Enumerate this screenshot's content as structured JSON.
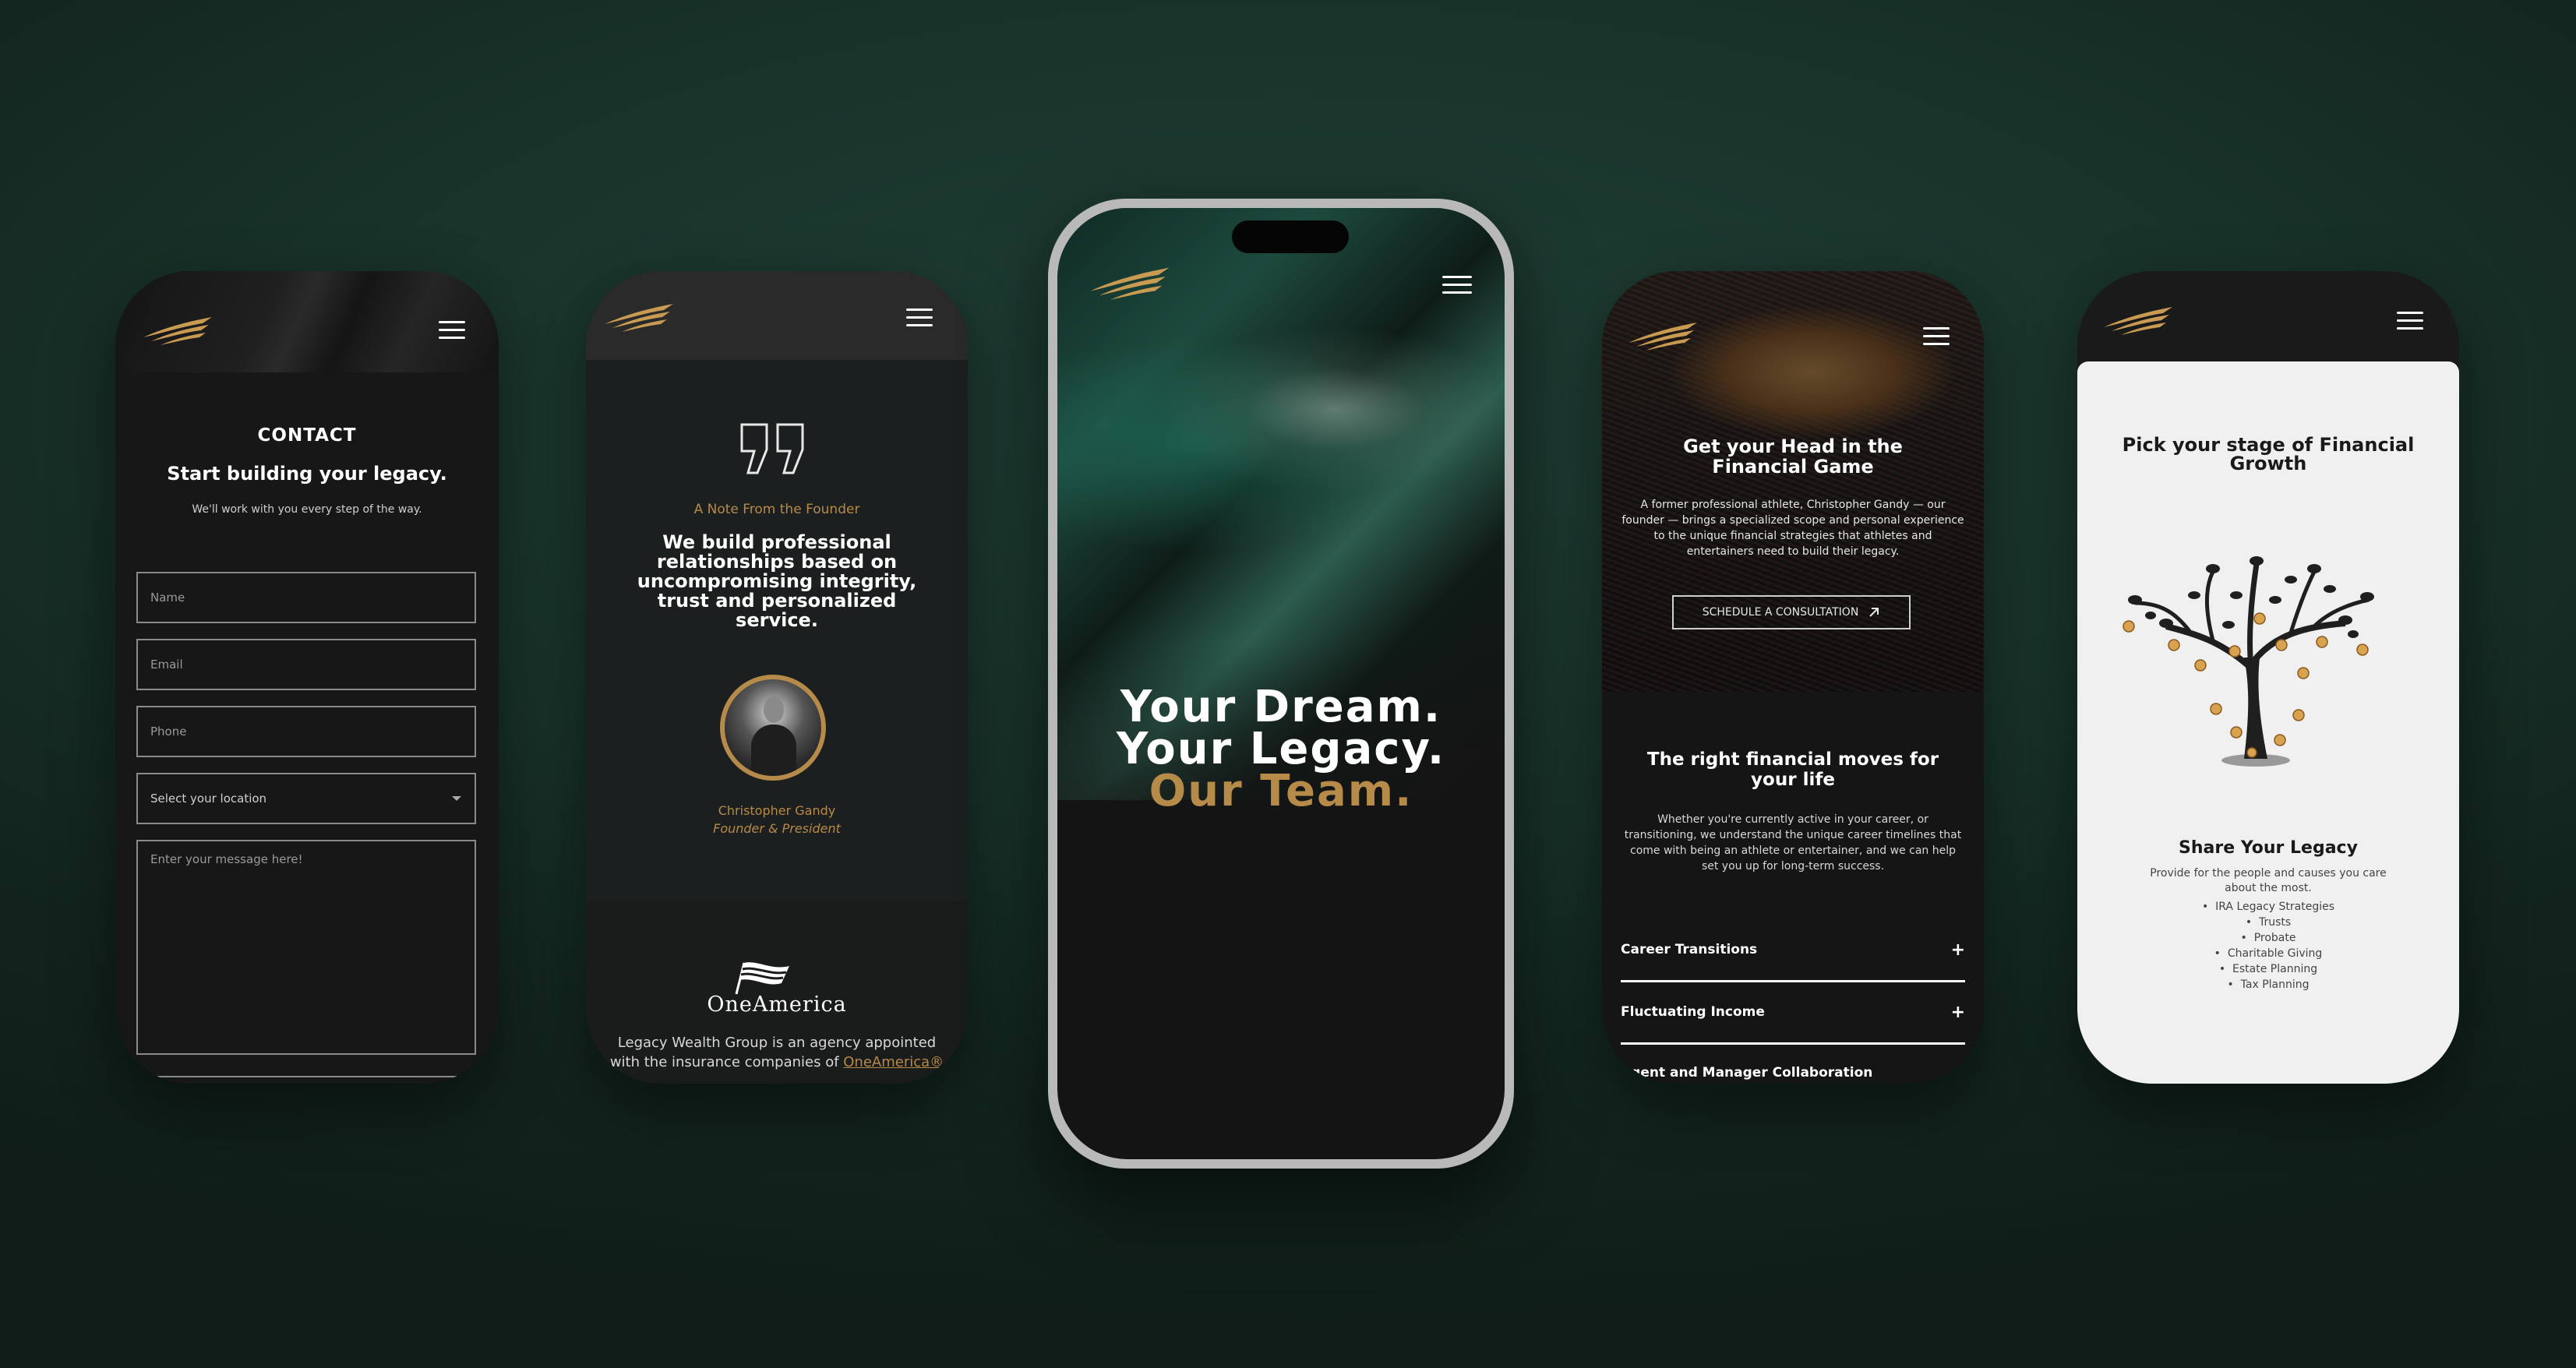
{
  "phone1": {
    "eyebrow": "CONTACT",
    "heading": "Start building your legacy.",
    "subtext": "We'll work with you every step of the way.",
    "fields": {
      "name_placeholder": "Name",
      "email_placeholder": "Email",
      "phone_placeholder": "Phone",
      "location_value": "Select your location",
      "message_placeholder": "Enter your message here!"
    }
  },
  "phone2": {
    "eyebrow": "A Note From the Founder",
    "quote": "We build professional relationships based on uncompromising integrity, trust and personalized service.",
    "founder_name": "Christopher Gandy",
    "founder_title": "Founder & President",
    "partner_logo": "OneAmerica",
    "footer_text": "Legacy Wealth Group is an agency appointed with the insurance companies of ",
    "footer_link": "OneAmerica®"
  },
  "phone3": {
    "line1": "Your Dream.",
    "line2": "Your Legacy.",
    "line3": "Our Team."
  },
  "phone4": {
    "hero_title": "Get your Head in the Financial Game",
    "hero_text": "A former professional athlete, Christopher Gandy — our founder — brings a specialized scope and personal experience to the unique financial strategies that athletes and entertainers need to build their legacy.",
    "cta_label": "SCHEDULE A CONSULTATION",
    "section_title": "The right financial moves for your life",
    "section_text": "Whether you're currently active in your career, or transitioning, we understand the unique career timelines that come with being an athlete or entertainer, and we can help set you up for long-term success.",
    "accordion": [
      {
        "label": "Career Transitions",
        "icon": "+"
      },
      {
        "label": "Fluctuating Income",
        "icon": "+"
      },
      {
        "label": "Agent and Manager Collaboration",
        "icon": "+"
      }
    ]
  },
  "phone5": {
    "title": "Pick your stage of Financial Growth",
    "card_title": "Share Your Legacy",
    "card_text": "Provide for the people and causes you care about the most.",
    "list": [
      "IRA Legacy Strategies",
      "Trusts",
      "Probate",
      "Charitable Giving",
      "Estate Planning",
      "Tax Planning"
    ]
  },
  "icons": [
    "logo-wings-icon",
    "hamburger-menu-icon",
    "quote-icon",
    "chevron-down-icon",
    "arrow-up-right-icon",
    "plus-icon",
    "money-tree-illustration"
  ],
  "colors": {
    "gold": "#b68a49",
    "dark": "#161616",
    "green_bg": "#183229",
    "light_card": "#f0f0f0"
  }
}
